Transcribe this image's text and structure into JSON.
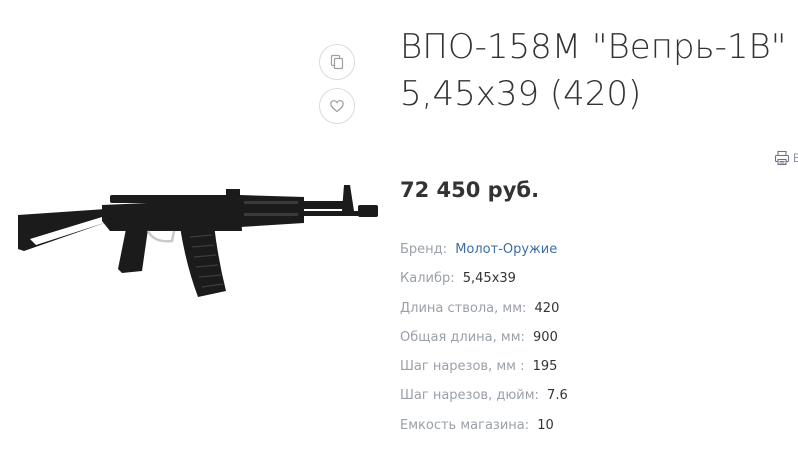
{
  "product": {
    "title_line1": "ВПО-158М \"Вепрь-1В\"",
    "title_line2": "5,45х39 (420)",
    "price": "72 450 руб."
  },
  "actions": {
    "compare_icon": "compare-icon",
    "favorite_icon": "heart-icon",
    "print_icon": "printer-icon",
    "print_label": "В"
  },
  "properties": [
    {
      "name": "Бренд:",
      "value": "Молот-Оружие"
    },
    {
      "name": "Калибр:",
      "value": "5,45х39"
    },
    {
      "name": "Длина ствола, мм:",
      "value": "420"
    },
    {
      "name": "Общая длина, мм:",
      "value": "900"
    },
    {
      "name": "Шаг нарезов, мм :",
      "value": "195"
    },
    {
      "name": "Шаг нарезов, дюйм:",
      "value": "7.6"
    },
    {
      "name": "Емкость магазина:",
      "value": "10"
    }
  ],
  "colors": {
    "link": "#3d6ea4",
    "muted": "#9aa0a8",
    "text": "#333333"
  }
}
